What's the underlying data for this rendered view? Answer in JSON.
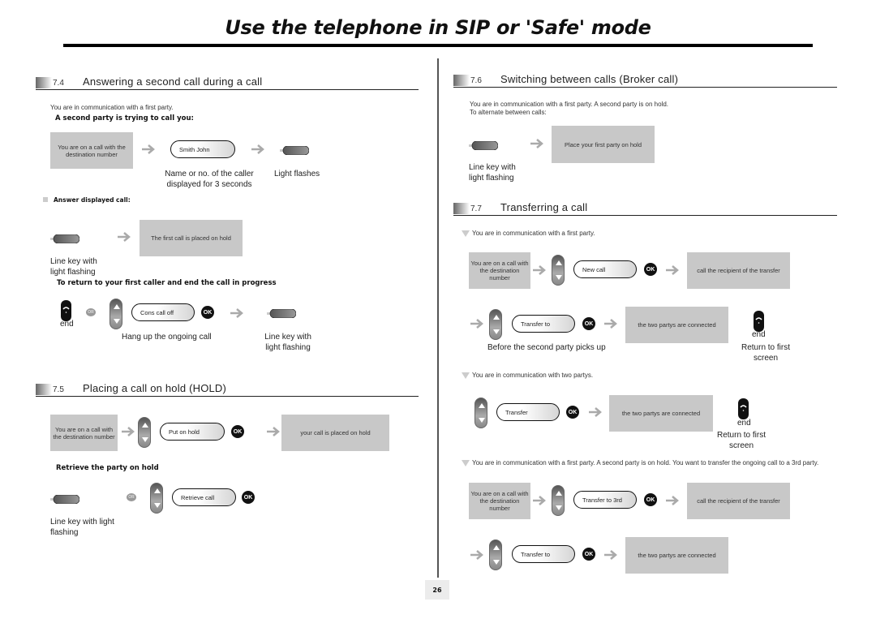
{
  "page": {
    "title": "Use the telephone in SIP or 'Safe' mode",
    "page_number": "26"
  },
  "colors": {
    "gray_box": "#c8c8c8",
    "arrow": "#aaaaaa",
    "ok_button": "#111111",
    "rule": "#000000"
  },
  "icons": {
    "arrow": "right-arrow-icon",
    "line_key": "line-key-icon",
    "nav_key": "navigation-key-icon",
    "ok": "ok-button-icon",
    "end": "hang-up-key-icon"
  },
  "s74": {
    "num": "7.4",
    "title": "Answering a second call during a call",
    "intro": "You are in communication with a first party.",
    "subhead": "A second party is trying to call you:",
    "box1": "You are on a call with the destination number",
    "display1": "Smith John",
    "cap_display": "Name or no. of the caller displayed for 3 seconds",
    "cap_light": "Light flashes",
    "answer_label": "Answer displayed call:",
    "box_hold": "The first call is placed on hold",
    "cap_linekey": "Line key with light flashing",
    "return_head": "To return to your first caller and end the call in progress",
    "end_label": "end",
    "or_label": "OR",
    "display2": "Cons call off",
    "ok_label": "OK",
    "cap_hangup": "Hang up the ongoing call",
    "cap_linekey2": "Line key with light flashing"
  },
  "s75": {
    "num": "7.5",
    "title": "Placing a call on hold (HOLD)",
    "box1": "You are on a call with the destination number",
    "display1": "Put on hold",
    "ok_label": "OK",
    "box_result": "your call is placed on hold",
    "retrieve_head": "Retrieve the party on hold",
    "or_label": "OR",
    "display2": "Retrieve call",
    "cap_linekey": "Line key with light flashing"
  },
  "s76": {
    "num": "7.6",
    "title": "Switching between calls (Broker call)",
    "intro1": "You are in communication with a first party. A second party is on hold.",
    "intro2": "To alternate between calls:",
    "box1": "Place your first party on hold",
    "cap_linekey": "Line key with light flashing"
  },
  "s77": {
    "num": "7.7",
    "title": "Transferring a call",
    "case1": {
      "intro": "You are in communication with a first party.",
      "box1": "You are on a call with the destination number",
      "display1": "New call",
      "box_recipient": "call the recipient of the transfer",
      "display2": "Transfer to",
      "box_connected": "the two partys are connected",
      "end_label": "end",
      "cap_before": "Before the second party picks up",
      "cap_return": "Return to first screen"
    },
    "case2": {
      "intro": "You are in communication with two partys.",
      "display1": "Transfer",
      "box_connected": "the two partys are connected",
      "end_label": "end",
      "cap_return": "Return to first screen"
    },
    "case3": {
      "intro": "You are in communication with a first party. A second party is on hold. You want to transfer the ongoing call to a 3rd party.",
      "box1": "You are on a call with the destination number",
      "display1": "Transfer to 3rd",
      "box_recipient": "call the recipient of the transfer",
      "display2": "Transfer to",
      "box_connected": "the two partys are connected"
    },
    "ok_label": "OK"
  }
}
